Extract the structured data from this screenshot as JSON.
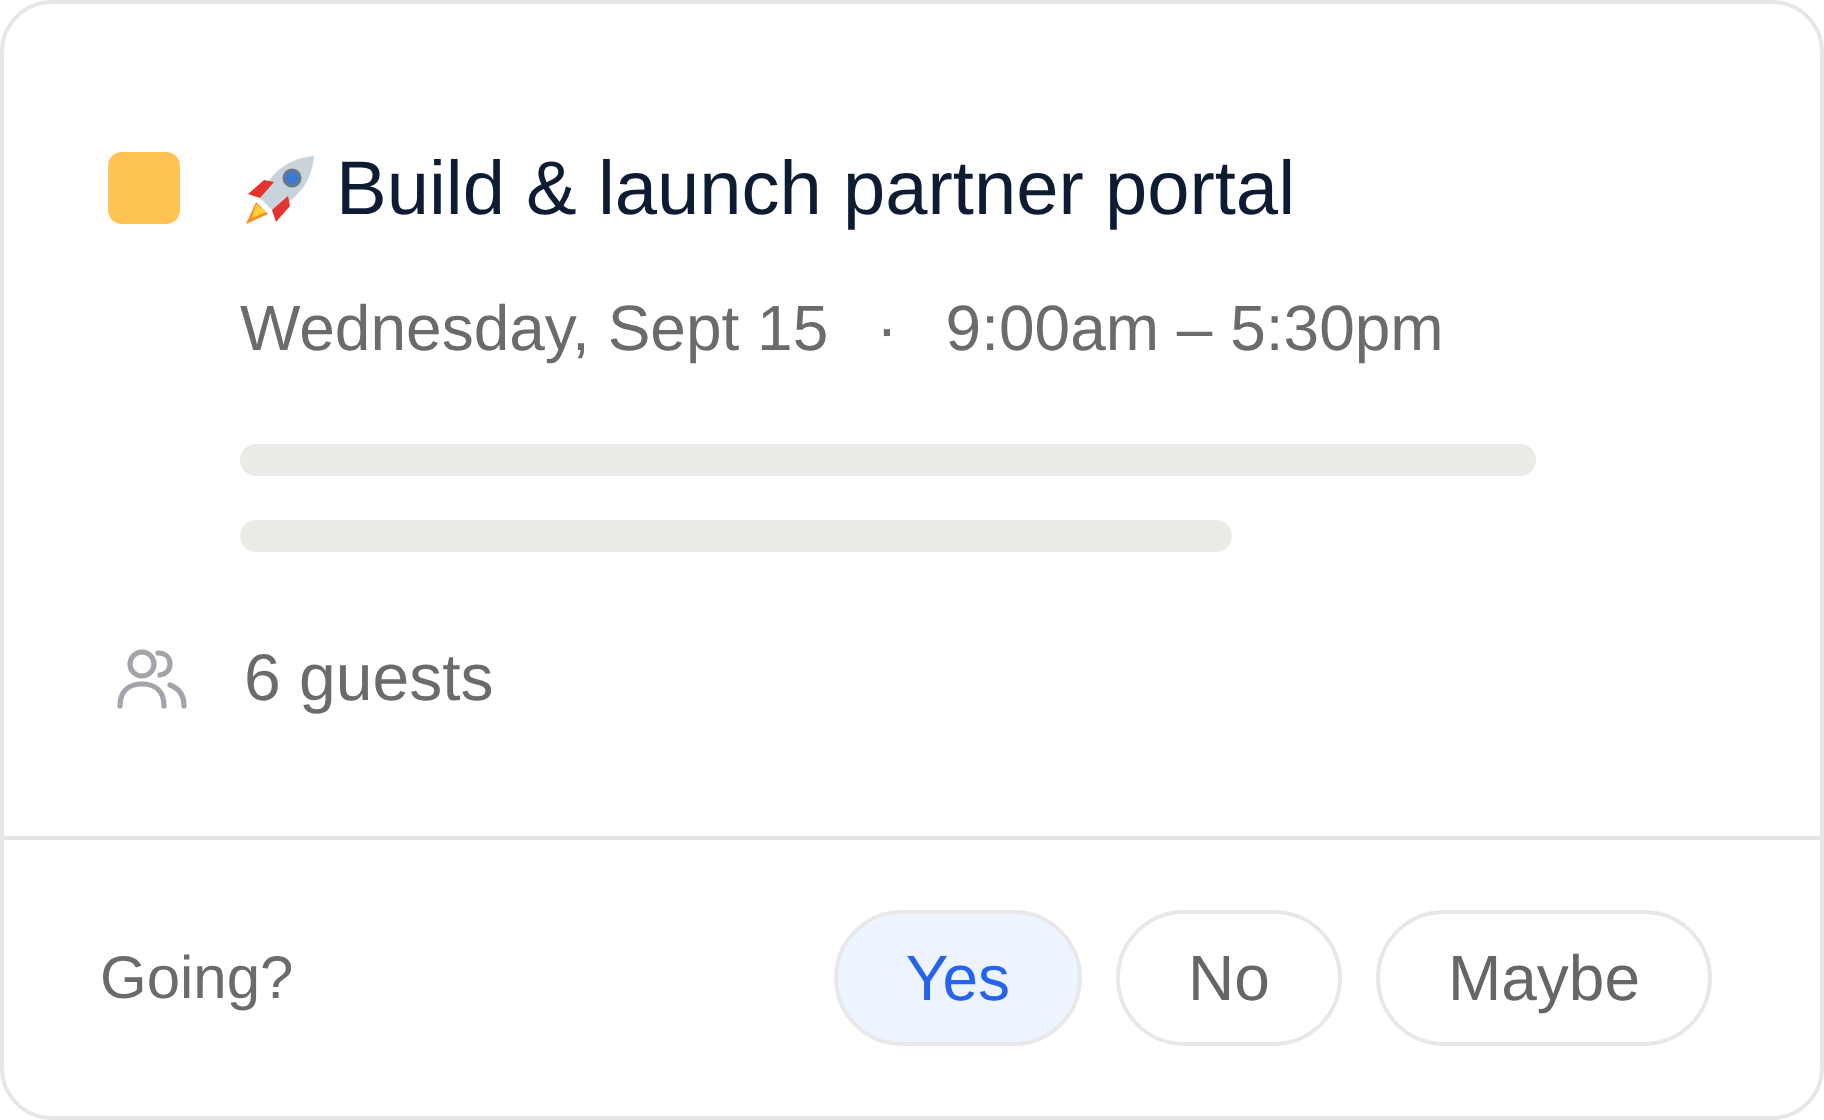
{
  "event": {
    "color": "#ffc452",
    "title": "Build & launch partner portal",
    "date": "Wednesday, Sept 15",
    "separator": "·",
    "time": "9:00am – 5:30pm",
    "guests": "6 guests"
  },
  "rsvp": {
    "prompt": "Going?",
    "options": [
      {
        "label": "Yes",
        "selected": true
      },
      {
        "label": "No",
        "selected": false
      },
      {
        "label": "Maybe",
        "selected": false
      }
    ]
  }
}
